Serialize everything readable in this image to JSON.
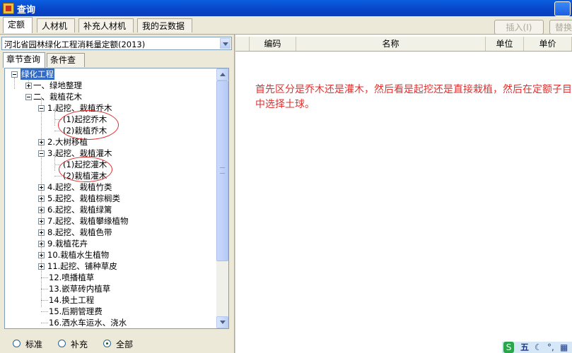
{
  "window": {
    "title": "查询"
  },
  "tabs": [
    "定额",
    "人材机",
    "补充人材机",
    "我的云数据"
  ],
  "toolbar": {
    "insert_label": "插入(I)",
    "replace_label": "替换"
  },
  "quota_combo": {
    "value": "河北省园林绿化工程消耗量定额(2013)"
  },
  "subtabs": [
    "章节查询",
    "条件查询"
  ],
  "tree": [
    "绿化工程",
    "一、绿地整理",
    "二、栽植花木",
    "1.起挖、栽植乔木",
    "(1)起挖乔木",
    "(2)栽植乔木",
    "2.大树移植",
    "3.起挖、栽植灌木",
    "(1)起挖灌木",
    "(2)栽植灌木",
    "4.起挖、栽植竹类",
    "5.起挖、栽植棕榈类",
    "6.起挖、栽植绿篱",
    "7.起挖、栽植攀缘植物",
    "8.起挖、栽植色带",
    "9.栽植花卉",
    "10.栽植水生植物",
    "11.起挖、铺种草皮",
    "12.喷播植草",
    "13.嵌草砖内植草",
    "14.换土工程",
    "15.后期管理费",
    "16.洒水车运水、浇水"
  ],
  "filter_radios": [
    {
      "label": "标准",
      "checked": false
    },
    {
      "label": "补充",
      "checked": false
    },
    {
      "label": "全部",
      "checked": true
    }
  ],
  "grid_headers": [
    "编码",
    "名称",
    "单位",
    "单价"
  ],
  "annotation_text": "首先区分是乔木还是灌木，然后看是起挖还是直接栽植，然后在定额子目中选择土球。",
  "tray": {
    "ime_char": "五"
  },
  "colors": {
    "annotation": "#e0302f",
    "selection": "#316ac5",
    "title_bar": "#0a5fe0"
  }
}
